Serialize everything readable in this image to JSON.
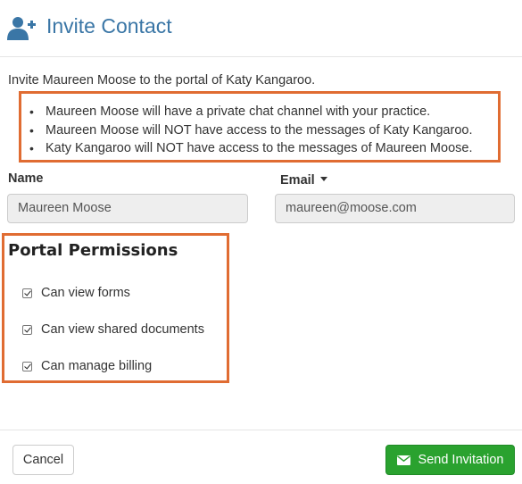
{
  "header": {
    "title": "Invite Contact",
    "icon": "user-plus-icon",
    "color": "#3a76a6"
  },
  "intro": "Invite Maureen Moose to the portal of Katy Kangaroo.",
  "notices": [
    "Maureen Moose will have a private chat channel with your practice.",
    "Maureen Moose will NOT have access to the messages of Katy Kangaroo.",
    "Katy Kangaroo will NOT have access to the messages of Maureen Moose."
  ],
  "form": {
    "name_label": "Name",
    "name_value": "Maureen Moose",
    "email_label": "Email",
    "email_value": "maureen@moose.com"
  },
  "permissions": {
    "title": "Portal Permissions",
    "items": [
      {
        "label": "Can view forms",
        "checked": true
      },
      {
        "label": "Can view shared documents",
        "checked": true
      },
      {
        "label": "Can manage billing",
        "checked": true
      }
    ]
  },
  "footer": {
    "cancel_label": "Cancel",
    "send_label": "Send Invitation",
    "send_icon": "envelope-icon",
    "send_color": "#2aa22f"
  },
  "highlight_color": "#e06c32"
}
